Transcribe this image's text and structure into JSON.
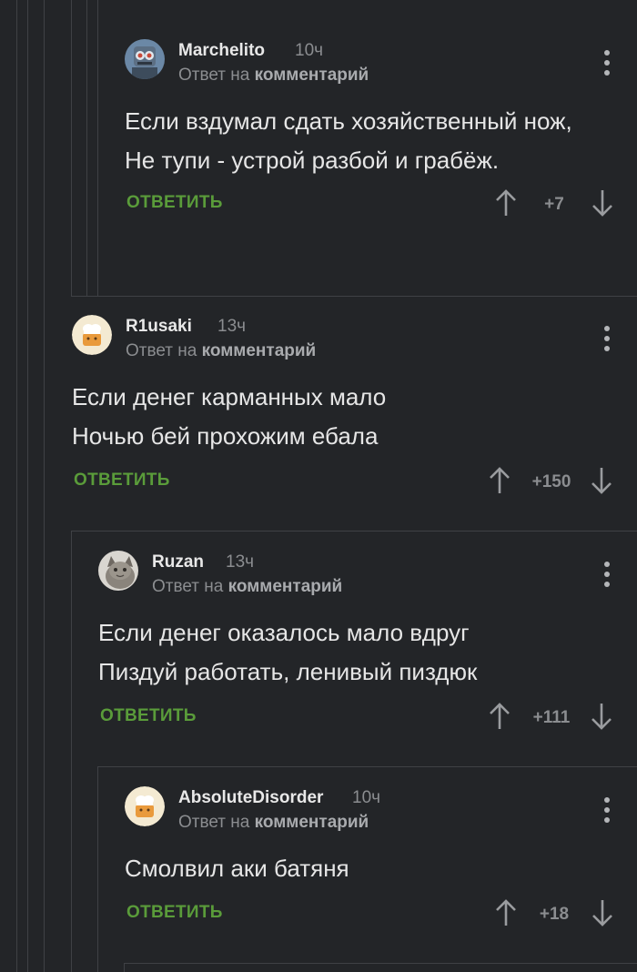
{
  "colors": {
    "background": "#232528",
    "thread_line": "#3f4145",
    "reply_button": "#5a9c3a",
    "muted_text": "#8b8d90"
  },
  "reply_to_prefix": "Ответ на",
  "reply_to_link": "комментарий",
  "comments": [
    {
      "username": "Marchelito",
      "time": "10ч",
      "avatar": "robot-avatar",
      "text": "Если вздумал сдать хозяйственный нож,\nНе тупи - устрой разбой и грабёж.",
      "reply_label": "ОТВЕТИТЬ",
      "score": "+7"
    },
    {
      "username": "R1usaki",
      "time": "13ч",
      "avatar": "default-chef-avatar",
      "text": "Если денег карманных мало\nНочью бей прохожим ебала",
      "reply_label": "ОТВЕТИТЬ",
      "score": "+150"
    },
    {
      "username": "Ruzan",
      "time": "13ч",
      "avatar": "cat-avatar",
      "text": "Если денег оказалось мало вдруг\nПиздуй работать, ленивый пиздюк",
      "reply_label": "ОТВЕТИТЬ",
      "score": "+111"
    },
    {
      "username": "AbsoluteDisorder",
      "time": "10ч",
      "avatar": "default-chef-avatar",
      "text": "Смолвил аки батяня",
      "reply_label": "ОТВЕТИТЬ",
      "score": "+18"
    }
  ]
}
